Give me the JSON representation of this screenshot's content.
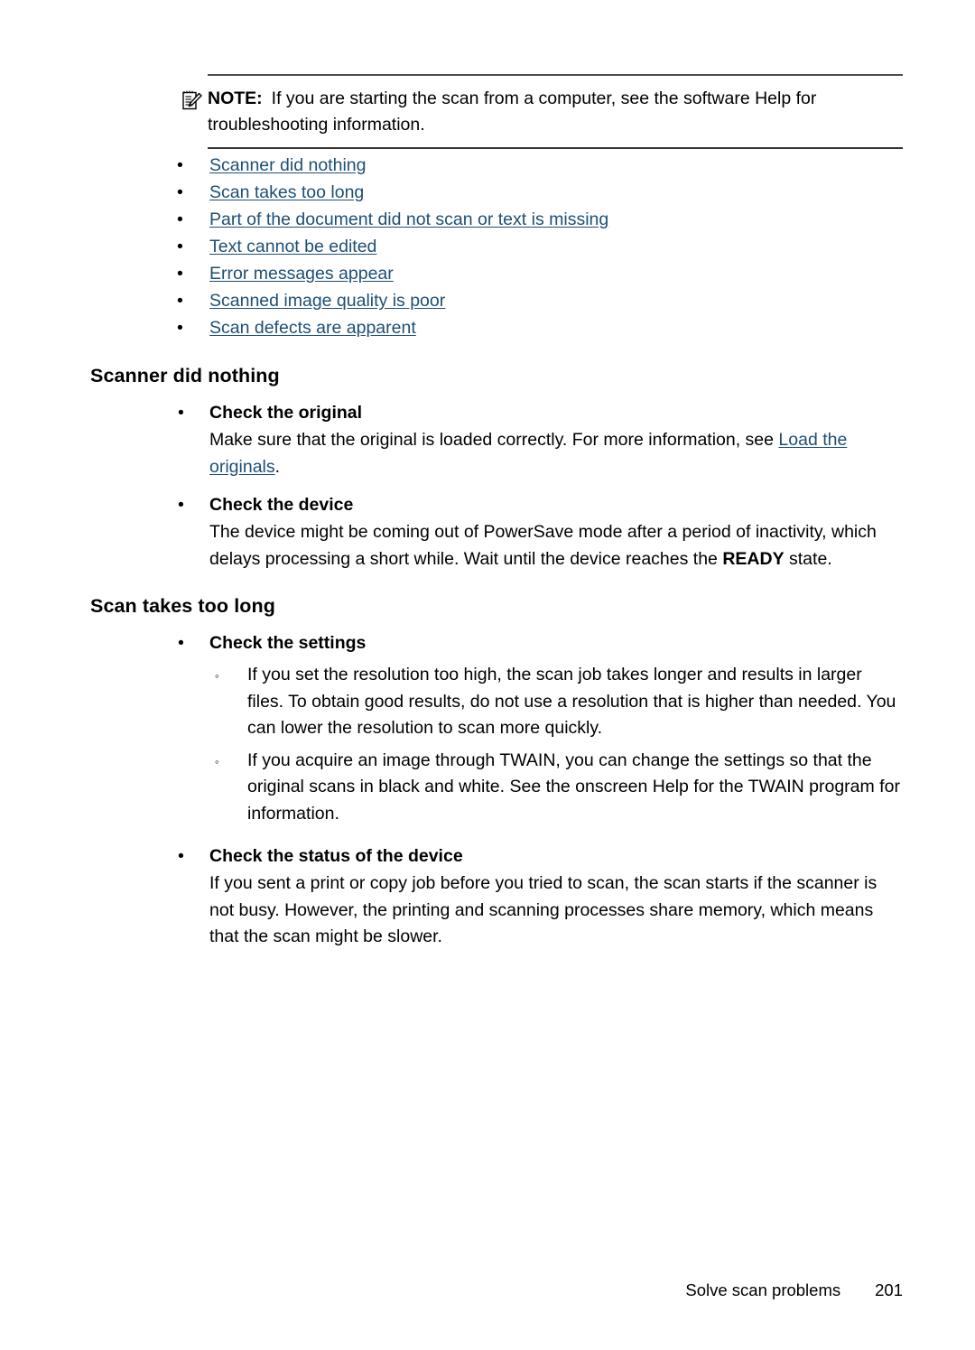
{
  "note": {
    "icon": "note-pencil-icon",
    "label": "NOTE:",
    "text": "If you are starting the scan from a computer, see the software Help for troubleshooting information."
  },
  "link_list": {
    "bullet": "•",
    "items": [
      {
        "label": "Scanner did nothing"
      },
      {
        "label": "Scan takes too long"
      },
      {
        "label": "Part of the document did not scan or text is missing"
      },
      {
        "label": "Text cannot be edited"
      },
      {
        "label": "Error messages appear"
      },
      {
        "label": "Scanned image quality is poor"
      },
      {
        "label": "Scan defects are apparent"
      }
    ]
  },
  "markers": {
    "bullet": "•",
    "sub_bullet": "◦"
  },
  "sections": {
    "scanner_did_nothing": {
      "title": "Scanner did nothing",
      "check_original": {
        "heading": "Check the original",
        "body_before": "Make sure that the original is loaded correctly. For more information, see ",
        "link": "Load the originals",
        "body_after": "."
      },
      "check_device": {
        "heading": "Check the device",
        "body_before": "The device might be coming out of PowerSave mode after a period of inactivity, which delays processing a short while. Wait until the device reaches the ",
        "emphasis": "READY",
        "body_after": " state."
      }
    },
    "scan_takes_too_long": {
      "title": "Scan takes too long",
      "check_settings": {
        "heading": "Check the settings",
        "sub_items": [
          "If you set the resolution too high, the scan job takes longer and results in larger files. To obtain good results, do not use a resolution that is higher than needed. You can lower the resolution to scan more quickly.",
          "If you acquire an image through TWAIN, you can change the settings so that the original scans in black and white. See the onscreen Help for the TWAIN program for information."
        ]
      },
      "check_status": {
        "heading": "Check the status of the device",
        "body": "If you sent a print or copy job before you tried to scan, the scan starts if the scanner is not busy. However, the printing and scanning processes share memory, which means that the scan might be slower."
      }
    }
  },
  "footer": {
    "label": "Solve scan problems",
    "page_number": "201"
  },
  "colors": {
    "link": "#1d4f76",
    "text": "#000000",
    "rule": "#3d3d3d"
  }
}
